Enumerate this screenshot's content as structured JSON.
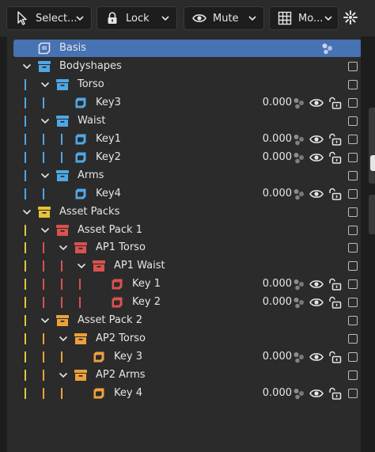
{
  "toolbar": {
    "select_label": "Select...",
    "lock_label": "Lock",
    "mute_label": "Mute",
    "mode_label": "Mo..."
  },
  "colors": {
    "blue": "#4fa7e6",
    "yellow": "#e8c33a",
    "red": "#d9524f",
    "orange": "#eca13b",
    "selection": "#4772b3"
  },
  "tree": [
    {
      "label": "Basis",
      "type": "basis",
      "selected": true
    },
    {
      "label": "Bodyshapes",
      "type": "folder",
      "color": "blue"
    },
    {
      "label": "Torso",
      "type": "folder",
      "color": "blue"
    },
    {
      "label": "Key3",
      "type": "key",
      "color": "blue",
      "value": "0.000"
    },
    {
      "label": "Waist",
      "type": "folder",
      "color": "blue"
    },
    {
      "label": "Key1",
      "type": "key",
      "color": "blue",
      "value": "0.000"
    },
    {
      "label": "Key2",
      "type": "key",
      "color": "blue",
      "value": "0.000"
    },
    {
      "label": "Arms",
      "type": "folder",
      "color": "blue"
    },
    {
      "label": "Key4",
      "type": "key",
      "color": "blue",
      "value": "0.000"
    },
    {
      "label": "Asset Packs",
      "type": "folder",
      "color": "yellow"
    },
    {
      "label": "Asset Pack 1",
      "type": "folder",
      "color": "red"
    },
    {
      "label": "AP1 Torso",
      "type": "folder",
      "color": "red"
    },
    {
      "label": "AP1 Waist",
      "type": "folder",
      "color": "red"
    },
    {
      "label": "Key 1",
      "type": "key",
      "color": "red",
      "value": "0.000"
    },
    {
      "label": "Key 2",
      "type": "key",
      "color": "red",
      "value": "0.000"
    },
    {
      "label": "Asset Pack 2",
      "type": "folder",
      "color": "orange"
    },
    {
      "label": "AP2 Torso",
      "type": "folder",
      "color": "orange"
    },
    {
      "label": "Key 3",
      "type": "key",
      "color": "orange",
      "value": "0.000"
    },
    {
      "label": "AP2 Arms",
      "type": "folder",
      "color": "orange"
    },
    {
      "label": "Key 4",
      "type": "key",
      "color": "orange",
      "value": "0.000"
    }
  ]
}
